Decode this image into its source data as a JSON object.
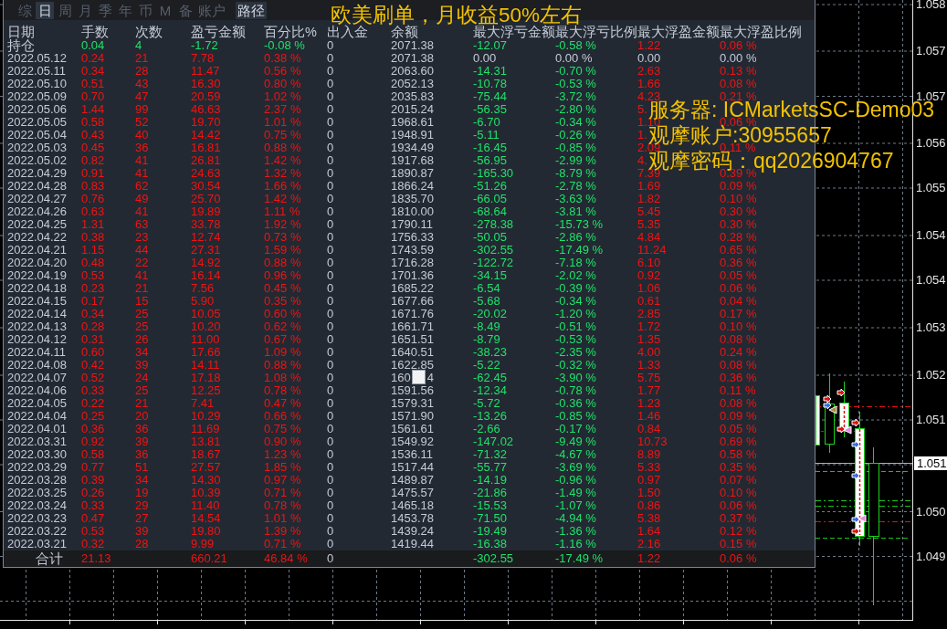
{
  "panel": {
    "tabs": [
      {
        "label": "综",
        "selected": false
      },
      {
        "label": "日",
        "selected": true
      },
      {
        "label": "周",
        "selected": false
      },
      {
        "label": "月",
        "selected": false
      },
      {
        "label": "季",
        "selected": false
      },
      {
        "label": "年",
        "selected": false
      },
      {
        "label": "币",
        "selected": false
      },
      {
        "label": "M",
        "selected": false
      },
      {
        "label": "备",
        "selected": false
      },
      {
        "label": "账户",
        "selected": false
      }
    ],
    "path_button": "路径",
    "table": {
      "columns": [
        "日期",
        "手数",
        "次数",
        "盈亏金额",
        "百分比%",
        "出入金",
        "余额",
        "最大浮亏金额",
        "最大浮亏比例",
        "最大浮盈金额",
        "最大浮盈比例"
      ],
      "open_position": {
        "label": "持仓",
        "lots": "0.04",
        "trades": "4",
        "pnl": "-1.72",
        "pnl_pct": "-0.08 %",
        "cash": "0",
        "balance": "2071.38",
        "max_loss": "-12.07",
        "max_loss_pct": "-0.58 %",
        "max_gain": "1.22",
        "max_gain_pct": "0.06 %",
        "pnl_group": {
          "color": "#1ee36b"
        },
        "loss_group": {
          "color": "#1ee36b"
        },
        "gain_group": {
          "color": "#f01414"
        }
      },
      "rows": [
        {
          "date": "2022.05.12",
          "lots": "0.24",
          "trades": "21",
          "pnl": "7.78",
          "pnl_pct": "0.38 %",
          "cash": "0",
          "balance": "2071.38",
          "max_loss": "0.00",
          "max_loss_pct": "0.00 %",
          "max_gain": "0.00",
          "max_gain_pct": "0.00 %",
          "pnl_group": {
            "color": "#f01414"
          },
          "loss_group": {
            "color": "#c3cbd7"
          },
          "gain_group": {
            "color": "#c3cbd7"
          }
        },
        {
          "date": "2022.05.11",
          "lots": "0.34",
          "trades": "28",
          "pnl": "11.47",
          "pnl_pct": "0.56 %",
          "cash": "0",
          "balance": "2063.60",
          "max_loss": "-14.31",
          "max_loss_pct": "-0.70 %",
          "max_gain": "2.63",
          "max_gain_pct": "0.13 %",
          "pnl_group": {
            "color": "#f01414"
          },
          "loss_group": {
            "color": "#1ee36b"
          },
          "gain_group": {
            "color": "#f01414"
          }
        },
        {
          "date": "2022.05.10",
          "lots": "0.51",
          "trades": "43",
          "pnl": "16.30",
          "pnl_pct": "0.80 %",
          "cash": "0",
          "balance": "2052.13",
          "max_loss": "-10.78",
          "max_loss_pct": "-0.53 %",
          "max_gain": "1.66",
          "max_gain_pct": "0.08 %",
          "pnl_group": {
            "color": "#f01414"
          },
          "loss_group": {
            "color": "#1ee36b"
          },
          "gain_group": {
            "color": "#f01414"
          }
        },
        {
          "date": "2022.05.09",
          "lots": "0.70",
          "trades": "47",
          "pnl": "20.59",
          "pnl_pct": "1.02 %",
          "cash": "0",
          "balance": "2035.83",
          "max_loss": "-75.44",
          "max_loss_pct": "-3.72 %",
          "max_gain": "4.23",
          "max_gain_pct": "0.21 %",
          "pnl_group": {
            "color": "#f01414"
          },
          "loss_group": {
            "color": "#1ee36b"
          },
          "gain_group": {
            "color": "#f01414"
          }
        },
        {
          "date": "2022.05.06",
          "lots": "1.44",
          "trades": "99",
          "pnl": "46.63",
          "pnl_pct": "2.37 %",
          "cash": "0",
          "balance": "2015.24",
          "max_loss": "-56.35",
          "max_loss_pct": "-2.80 %",
          "max_gain": "5.",
          "pnl_group": {
            "color": "#f01414"
          },
          "loss_group": {
            "color": "#1ee36b"
          },
          "gain_group": {
            "color": "#f01414"
          }
        },
        {
          "date": "2022.05.05",
          "lots": "0.58",
          "trades": "52",
          "pnl": "19.70",
          "pnl_pct": "1.01 %",
          "cash": "0",
          "balance": "1968.61",
          "max_loss": "-6.70",
          "max_loss_pct": "-0.34 %",
          "max_gain": "1.10",
          "max_gain_pct": "0.06 %",
          "pnl_group": {
            "color": "#f01414"
          },
          "loss_group": {
            "color": "#1ee36b"
          },
          "gain_group": {
            "color": "#f01414"
          }
        },
        {
          "date": "2022.05.04",
          "lots": "0.43",
          "trades": "40",
          "pnl": "14.42",
          "pnl_pct": "0.75 %",
          "cash": "0",
          "balance": "1948.91",
          "max_loss": "-5.11",
          "max_loss_pct": "-0.26 %",
          "max_gain": "1.",
          "pnl_group": {
            "color": "#f01414"
          },
          "loss_group": {
            "color": "#1ee36b"
          },
          "gain_group": {
            "color": "#f01414"
          }
        },
        {
          "date": "2022.05.03",
          "lots": "0.45",
          "trades": "36",
          "pnl": "16.81",
          "pnl_pct": "0.88 %",
          "cash": "0",
          "balance": "1934.49",
          "max_loss": "-16.45",
          "max_loss_pct": "-0.85 %",
          "max_gain": "2.09",
          "max_gain_pct": "0.11 %",
          "pnl_group": {
            "color": "#f01414"
          },
          "loss_group": {
            "color": "#1ee36b"
          },
          "gain_group": {
            "color": "#f01414"
          }
        },
        {
          "date": "2022.05.02",
          "lots": "0.82",
          "trades": "41",
          "pnl": "26.81",
          "pnl_pct": "1.42 %",
          "cash": "0",
          "balance": "1917.68",
          "max_loss": "-56.95",
          "max_loss_pct": "-2.99 %",
          "max_gain": "4.",
          "pnl_group": {
            "color": "#f01414"
          },
          "loss_group": {
            "color": "#1ee36b"
          },
          "gain_group": {
            "color": "#f01414"
          }
        },
        {
          "date": "2022.04.29",
          "lots": "0.91",
          "trades": "41",
          "pnl": "24.63",
          "pnl_pct": "1.32 %",
          "cash": "0",
          "balance": "1890.87",
          "max_loss": "-165.30",
          "max_loss_pct": "-8.79 %",
          "max_gain": "7.39",
          "max_gain_pct": "0.39 %",
          "pnl_group": {
            "color": "#f01414"
          },
          "loss_group": {
            "color": "#1ee36b"
          },
          "gain_group": {
            "color": "#f01414"
          }
        },
        {
          "date": "2022.04.28",
          "lots": "0.83",
          "trades": "62",
          "pnl": "30.54",
          "pnl_pct": "1.66 %",
          "cash": "0",
          "balance": "1866.24",
          "max_loss": "-51.26",
          "max_loss_pct": "-2.78 %",
          "max_gain": "1.69",
          "max_gain_pct": "0.09 %",
          "pnl_group": {
            "color": "#f01414"
          },
          "loss_group": {
            "color": "#1ee36b"
          },
          "gain_group": {
            "color": "#f01414"
          }
        },
        {
          "date": "2022.04.27",
          "lots": "0.76",
          "trades": "49",
          "pnl": "25.70",
          "pnl_pct": "1.42 %",
          "cash": "0",
          "balance": "1835.70",
          "max_loss": "-66.05",
          "max_loss_pct": "-3.63 %",
          "max_gain": "1.82",
          "max_gain_pct": "0.10 %",
          "pnl_group": {
            "color": "#f01414"
          },
          "loss_group": {
            "color": "#1ee36b"
          },
          "gain_group": {
            "color": "#f01414"
          }
        },
        {
          "date": "2022.04.26",
          "lots": "0.63",
          "trades": "41",
          "pnl": "19.89",
          "pnl_pct": "1.11 %",
          "cash": "0",
          "balance": "1810.00",
          "max_loss": "-68.64",
          "max_loss_pct": "-3.81 %",
          "max_gain": "5.45",
          "max_gain_pct": "0.30 %",
          "pnl_group": {
            "color": "#f01414"
          },
          "loss_group": {
            "color": "#1ee36b"
          },
          "gain_group": {
            "color": "#f01414"
          }
        },
        {
          "date": "2022.04.25",
          "lots": "1.31",
          "trades": "63",
          "pnl": "33.78",
          "pnl_pct": "1.92 %",
          "cash": "0",
          "balance": "1790.11",
          "max_loss": "-278.38",
          "max_loss_pct": "-15.73 %",
          "max_gain": "5.35",
          "max_gain_pct": "0.30 %",
          "pnl_group": {
            "color": "#f01414"
          },
          "loss_group": {
            "color": "#1ee36b"
          },
          "gain_group": {
            "color": "#f01414"
          }
        },
        {
          "date": "2022.04.22",
          "lots": "0.38",
          "trades": "23",
          "pnl": "12.74",
          "pnl_pct": "0.73 %",
          "cash": "0",
          "balance": "1756.33",
          "max_loss": "-50.05",
          "max_loss_pct": "-2.86 %",
          "max_gain": "4.84",
          "max_gain_pct": "0.28 %",
          "pnl_group": {
            "color": "#f01414"
          },
          "loss_group": {
            "color": "#1ee36b"
          },
          "gain_group": {
            "color": "#f01414"
          }
        },
        {
          "date": "2022.04.21",
          "lots": "1.15",
          "trades": "44",
          "pnl": "27.31",
          "pnl_pct": "1.59 %",
          "cash": "0",
          "balance": "1743.59",
          "max_loss": "-302.55",
          "max_loss_pct": "-17.49 %",
          "max_gain": "11.24",
          "max_gain_pct": "0.65 %",
          "pnl_group": {
            "color": "#f01414"
          },
          "loss_group": {
            "color": "#1ee36b"
          },
          "gain_group": {
            "color": "#f01414"
          }
        },
        {
          "date": "2022.04.20",
          "lots": "0.48",
          "trades": "22",
          "pnl": "14.92",
          "pnl_pct": "0.88 %",
          "cash": "0",
          "balance": "1716.28",
          "max_loss": "-122.72",
          "max_loss_pct": "-7.18 %",
          "max_gain": "6.10",
          "max_gain_pct": "0.36 %",
          "pnl_group": {
            "color": "#f01414"
          },
          "loss_group": {
            "color": "#1ee36b"
          },
          "gain_group": {
            "color": "#f01414"
          }
        },
        {
          "date": "2022.04.19",
          "lots": "0.53",
          "trades": "41",
          "pnl": "16.14",
          "pnl_pct": "0.96 %",
          "cash": "0",
          "balance": "1701.36",
          "max_loss": "-34.15",
          "max_loss_pct": "-2.02 %",
          "max_gain": "0.92",
          "max_gain_pct": "0.05 %",
          "pnl_group": {
            "color": "#f01414"
          },
          "loss_group": {
            "color": "#1ee36b"
          },
          "gain_group": {
            "color": "#f01414"
          }
        },
        {
          "date": "2022.04.18",
          "lots": "0.23",
          "trades": "21",
          "pnl": "7.56",
          "pnl_pct": "0.45 %",
          "cash": "0",
          "balance": "1685.22",
          "max_loss": "-6.54",
          "max_loss_pct": "-0.39 %",
          "max_gain": "1.06",
          "max_gain_pct": "0.06 %",
          "pnl_group": {
            "color": "#f01414"
          },
          "loss_group": {
            "color": "#1ee36b"
          },
          "gain_group": {
            "color": "#f01414"
          }
        },
        {
          "date": "2022.04.15",
          "lots": "0.17",
          "trades": "15",
          "pnl": "5.90",
          "pnl_pct": "0.35 %",
          "cash": "0",
          "balance": "1677.66",
          "max_loss": "-5.68",
          "max_loss_pct": "-0.34 %",
          "max_gain": "0.61",
          "max_gain_pct": "0.04 %",
          "pnl_group": {
            "color": "#f01414"
          },
          "loss_group": {
            "color": "#1ee36b"
          },
          "gain_group": {
            "color": "#f01414"
          }
        },
        {
          "date": "2022.04.14",
          "lots": "0.34",
          "trades": "25",
          "pnl": "10.05",
          "pnl_pct": "0.60 %",
          "cash": "0",
          "balance": "1671.76",
          "max_loss": "-20.02",
          "max_loss_pct": "-1.20 %",
          "max_gain": "2.85",
          "max_gain_pct": "0.17 %",
          "pnl_group": {
            "color": "#f01414"
          },
          "loss_group": {
            "color": "#1ee36b"
          },
          "gain_group": {
            "color": "#f01414"
          }
        },
        {
          "date": "2022.04.13",
          "lots": "0.28",
          "trades": "25",
          "pnl": "10.20",
          "pnl_pct": "0.62 %",
          "cash": "0",
          "balance": "1661.71",
          "max_loss": "-8.49",
          "max_loss_pct": "-0.51 %",
          "max_gain": "1.72",
          "max_gain_pct": "0.10 %",
          "pnl_group": {
            "color": "#f01414"
          },
          "loss_group": {
            "color": "#1ee36b"
          },
          "gain_group": {
            "color": "#f01414"
          }
        },
        {
          "date": "2022.04.12",
          "lots": "0.31",
          "trades": "26",
          "pnl": "11.00",
          "pnl_pct": "0.67 %",
          "cash": "0",
          "balance": "1651.51",
          "max_loss": "-8.79",
          "max_loss_pct": "-0.53 %",
          "max_gain": "1.35",
          "max_gain_pct": "0.08 %",
          "pnl_group": {
            "color": "#f01414"
          },
          "loss_group": {
            "color": "#1ee36b"
          },
          "gain_group": {
            "color": "#f01414"
          }
        },
        {
          "date": "2022.04.11",
          "lots": "0.60",
          "trades": "34",
          "pnl": "17.66",
          "pnl_pct": "1.09 %",
          "cash": "0",
          "balance": "1640.51",
          "max_loss": "-38.23",
          "max_loss_pct": "-2.35 %",
          "max_gain": "4.00",
          "max_gain_pct": "0.24 %",
          "pnl_group": {
            "color": "#f01414"
          },
          "loss_group": {
            "color": "#1ee36b"
          },
          "gain_group": {
            "color": "#f01414"
          }
        },
        {
          "date": "2022.04.08",
          "lots": "0.42",
          "trades": "39",
          "pnl": "14.11",
          "pnl_pct": "0.88 %",
          "cash": "0",
          "balance": "1622.85",
          "max_loss": "-5.22",
          "max_loss_pct": "-0.32 %",
          "max_gain": "1.33",
          "max_gain_pct": "0.08 %",
          "pnl_group": {
            "color": "#f01414"
          },
          "loss_group": {
            "color": "#1ee36b"
          },
          "gain_group": {
            "color": "#f01414"
          }
        },
        {
          "date": "2022.04.07",
          "lots": "0.52",
          "trades": "24",
          "pnl": "17.18",
          "pnl_pct": "1.08 %",
          "cash": "0",
          "balance_parts": [
            "160",
            "4"
          ],
          "max_loss": "-62.45",
          "max_loss_pct": "-3.90 %",
          "max_gain": "5.75",
          "max_gain_pct": "0.36 %",
          "pnl_group": {
            "color": "#f01414"
          },
          "loss_group": {
            "color": "#1ee36b"
          },
          "gain_group": {
            "color": "#f01414"
          }
        },
        {
          "date": "2022.04.06",
          "lots": "0.33",
          "trades": "25",
          "pnl": "12.25",
          "pnl_pct": "0.78 %",
          "cash": "0",
          "balance": "1591.56",
          "max_loss": "-12.34",
          "max_loss_pct": "-0.78 %",
          "max_gain": "1.77",
          "max_gain_pct": "0.11 %",
          "pnl_group": {
            "color": "#f01414"
          },
          "loss_group": {
            "color": "#1ee36b"
          },
          "gain_group": {
            "color": "#f01414"
          }
        },
        {
          "date": "2022.04.05",
          "lots": "0.22",
          "trades": "21",
          "pnl": "7.41",
          "pnl_pct": "0.47 %",
          "cash": "0",
          "balance": "1579.31",
          "max_loss": "-5.72",
          "max_loss_pct": "-0.36 %",
          "max_gain": "1.23",
          "max_gain_pct": "0.08 %",
          "pnl_group": {
            "color": "#f01414"
          },
          "loss_group": {
            "color": "#1ee36b"
          },
          "gain_group": {
            "color": "#f01414"
          }
        },
        {
          "date": "2022.04.04",
          "lots": "0.25",
          "trades": "20",
          "pnl": "10.29",
          "pnl_pct": "0.66 %",
          "cash": "0",
          "balance": "1571.90",
          "max_loss": "-13.26",
          "max_loss_pct": "-0.85 %",
          "max_gain": "1.46",
          "max_gain_pct": "0.09 %",
          "pnl_group": {
            "color": "#f01414"
          },
          "loss_group": {
            "color": "#1ee36b"
          },
          "gain_group": {
            "color": "#f01414"
          }
        },
        {
          "date": "2022.04.01",
          "lots": "0.36",
          "trades": "36",
          "pnl": "11.69",
          "pnl_pct": "0.75 %",
          "cash": "0",
          "balance": "1561.61",
          "max_loss": "-2.66",
          "max_loss_pct": "-0.17 %",
          "max_gain": "0.84",
          "max_gain_pct": "0.05 %",
          "pnl_group": {
            "color": "#f01414"
          },
          "loss_group": {
            "color": "#1ee36b"
          },
          "gain_group": {
            "color": "#f01414"
          }
        },
        {
          "date": "2022.03.31",
          "lots": "0.92",
          "trades": "39",
          "pnl": "13.81",
          "pnl_pct": "0.90 %",
          "cash": "0",
          "balance": "1549.92",
          "max_loss": "-147.02",
          "max_loss_pct": "-9.49 %",
          "max_gain": "10.73",
          "max_gain_pct": "0.69 %",
          "pnl_group": {
            "color": "#f01414"
          },
          "loss_group": {
            "color": "#1ee36b"
          },
          "gain_group": {
            "color": "#f01414"
          }
        },
        {
          "date": "2022.03.30",
          "lots": "0.58",
          "trades": "36",
          "pnl": "18.67",
          "pnl_pct": "1.23 %",
          "cash": "0",
          "balance": "1536.11",
          "max_loss": "-71.32",
          "max_loss_pct": "-4.67 %",
          "max_gain": "8.89",
          "max_gain_pct": "0.58 %",
          "pnl_group": {
            "color": "#f01414"
          },
          "loss_group": {
            "color": "#1ee36b"
          },
          "gain_group": {
            "color": "#f01414"
          }
        },
        {
          "date": "2022.03.29",
          "lots": "0.77",
          "trades": "51",
          "pnl": "27.57",
          "pnl_pct": "1.85 %",
          "cash": "0",
          "balance": "1517.44",
          "max_loss": "-55.77",
          "max_loss_pct": "-3.69 %",
          "max_gain": "5.33",
          "max_gain_pct": "0.35 %",
          "pnl_group": {
            "color": "#f01414"
          },
          "loss_group": {
            "color": "#1ee36b"
          },
          "gain_group": {
            "color": "#f01414"
          }
        },
        {
          "date": "2022.03.28",
          "lots": "0.39",
          "trades": "34",
          "pnl": "14.30",
          "pnl_pct": "0.97 %",
          "cash": "0",
          "balance": "1489.87",
          "max_loss": "-14.19",
          "max_loss_pct": "-0.96 %",
          "max_gain": "0.97",
          "max_gain_pct": "0.07 %",
          "pnl_group": {
            "color": "#f01414"
          },
          "loss_group": {
            "color": "#1ee36b"
          },
          "gain_group": {
            "color": "#f01414"
          }
        },
        {
          "date": "2022.03.25",
          "lots": "0.26",
          "trades": "19",
          "pnl": "10.39",
          "pnl_pct": "0.71 %",
          "cash": "0",
          "balance": "1475.57",
          "max_loss": "-21.86",
          "max_loss_pct": "-1.49 %",
          "max_gain": "1.50",
          "max_gain_pct": "0.10 %",
          "pnl_group": {
            "color": "#f01414"
          },
          "loss_group": {
            "color": "#1ee36b"
          },
          "gain_group": {
            "color": "#f01414"
          }
        },
        {
          "date": "2022.03.24",
          "lots": "0.33",
          "trades": "29",
          "pnl": "11.40",
          "pnl_pct": "0.78 %",
          "cash": "0",
          "balance": "1465.18",
          "max_loss": "-15.53",
          "max_loss_pct": "-1.07 %",
          "max_gain": "0.86",
          "max_gain_pct": "0.06 %",
          "pnl_group": {
            "color": "#f01414"
          },
          "loss_group": {
            "color": "#1ee36b"
          },
          "gain_group": {
            "color": "#f01414"
          }
        },
        {
          "date": "2022.03.23",
          "lots": "0.47",
          "trades": "27",
          "pnl": "14.54",
          "pnl_pct": "1.01 %",
          "cash": "0",
          "balance": "1453.78",
          "max_loss": "-71.50",
          "max_loss_pct": "-4.94 %",
          "max_gain": "5.38",
          "max_gain_pct": "0.37 %",
          "pnl_group": {
            "color": "#f01414"
          },
          "loss_group": {
            "color": "#1ee36b"
          },
          "gain_group": {
            "color": "#f01414"
          }
        },
        {
          "date": "2022.03.22",
          "lots": "0.53",
          "trades": "39",
          "pnl": "19.80",
          "pnl_pct": "1.39 %",
          "cash": "0",
          "balance": "1439.24",
          "max_loss": "-19.49",
          "max_loss_pct": "-1.36 %",
          "max_gain": "1.64",
          "max_gain_pct": "0.12 %",
          "pnl_group": {
            "color": "#f01414"
          },
          "loss_group": {
            "color": "#1ee36b"
          },
          "gain_group": {
            "color": "#f01414"
          }
        },
        {
          "date": "2022.03.21",
          "lots": "0.32",
          "trades": "28",
          "pnl": "9.99",
          "pnl_pct": "0.71 %",
          "cash": "0",
          "balance": "1419.44",
          "max_loss": "-16.38",
          "max_loss_pct": "-1.16 %",
          "max_gain": "2.16",
          "max_gain_pct": "0.15 %",
          "pnl_group": {
            "color": "#f01414"
          },
          "loss_group": {
            "color": "#1ee36b"
          },
          "gain_group": {
            "color": "#f01414"
          }
        }
      ],
      "total": {
        "label": "合计",
        "lots": "21.13",
        "pnl": "660.21",
        "pnl_pct": "46.84 %",
        "cash": "0",
        "max_loss": "-302.55",
        "max_loss_pct": "-17.49 %",
        "max_gain": "1.22",
        "max_gain_pct": "0.06 %",
        "pnl_group": {
          "color": "#f01414"
        },
        "loss_group": {
          "color": "#1ee36b"
        },
        "gain_group": {
          "color": "#f01414"
        }
      }
    }
  },
  "overlay": {
    "headline": "欧美刷单，月收益50%左右",
    "lines": [
      "服务器: ICMarketsSC-Demo03",
      "观摩账户:30955657",
      "观摩密码：qq2026904767"
    ]
  },
  "chart": {
    "price_labels": [
      "1.058",
      "1.057",
      "1.057",
      "1.056",
      "1.055",
      "1.054",
      "1.054",
      "1.053",
      "1.052",
      "1.051",
      "1.050",
      "1.049"
    ],
    "current_price": "1.051"
  }
}
